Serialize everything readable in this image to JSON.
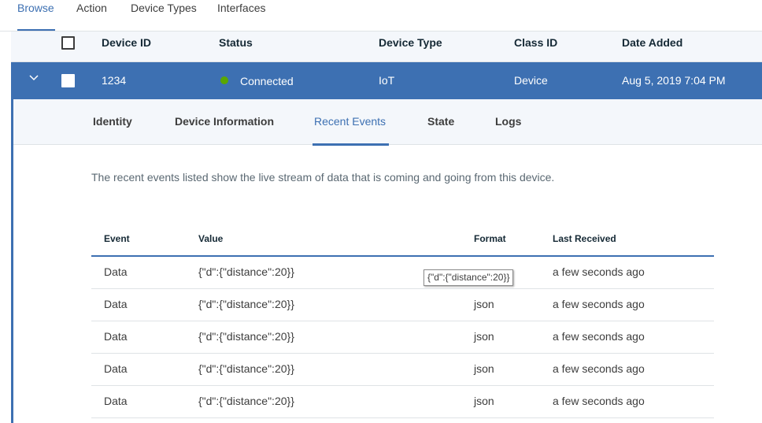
{
  "nav": {
    "tabs": [
      {
        "label": "Browse",
        "active": true
      },
      {
        "label": "Action",
        "active": false
      },
      {
        "label": "Device Types",
        "active": false
      },
      {
        "label": "Interfaces",
        "active": false
      }
    ]
  },
  "device_table": {
    "headers": [
      "Device ID",
      "Status",
      "Device Type",
      "Class ID",
      "Date Added"
    ],
    "selected_row": {
      "device_id": "1234",
      "status": "Connected",
      "device_type": "IoT",
      "class_id": "Device",
      "date_added": "Aug 5, 2019 7:04 PM",
      "status_color": "#5aa700"
    }
  },
  "detail": {
    "tabs": [
      {
        "label": "Identity",
        "active": false
      },
      {
        "label": "Device Information",
        "active": false
      },
      {
        "label": "Recent Events",
        "active": true
      },
      {
        "label": "State",
        "active": false
      },
      {
        "label": "Logs",
        "active": false
      }
    ],
    "description": "The recent events listed show the live stream of data that is coming and going from this device.",
    "events": {
      "headers": [
        "Event",
        "Value",
        "Format",
        "Last Received"
      ],
      "rows": [
        {
          "event": "Data",
          "value": "{\"d\":{\"distance\":20}}",
          "format": "",
          "last_received": "a few seconds ago"
        },
        {
          "event": "Data",
          "value": "{\"d\":{\"distance\":20}}",
          "format": "json",
          "last_received": "a few seconds ago"
        },
        {
          "event": "Data",
          "value": "{\"d\":{\"distance\":20}}",
          "format": "json",
          "last_received": "a few seconds ago"
        },
        {
          "event": "Data",
          "value": "{\"d\":{\"distance\":20}}",
          "format": "json",
          "last_received": "a few seconds ago"
        },
        {
          "event": "Data",
          "value": "{\"d\":{\"distance\":20}}",
          "format": "json",
          "last_received": "a few seconds ago"
        }
      ]
    },
    "tooltip": "{\"d\":{\"distance\":20}}"
  },
  "colors": {
    "accent": "#3d70b2",
    "connected": "#5aa700"
  }
}
